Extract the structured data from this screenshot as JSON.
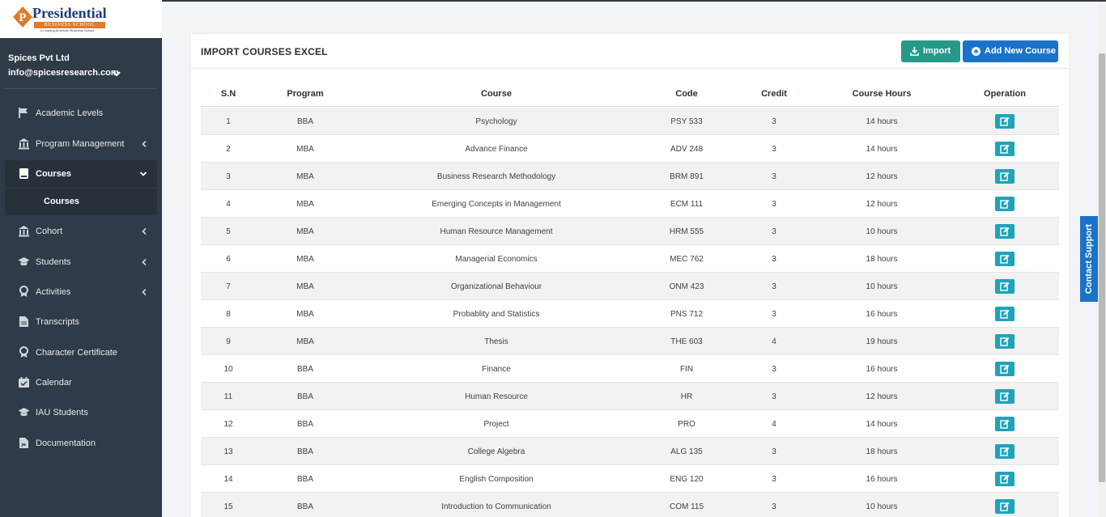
{
  "brand": {
    "title": "Presidential",
    "subtitle": "BUSINESS SCHOOL",
    "tagline": "A Leading American Business School"
  },
  "user": {
    "org": "Spices Pvt Ltd",
    "email": "info@spicesresearch.com"
  },
  "sidebar": {
    "items": [
      {
        "label": "Academic Levels",
        "icon": "flag-icon",
        "caret": false
      },
      {
        "label": "Program Management",
        "icon": "institution-icon",
        "caret": true
      },
      {
        "label": "Courses",
        "icon": "book-icon",
        "caret": true,
        "active": true
      },
      {
        "label": "Cohort",
        "icon": "institution-icon",
        "caret": true
      },
      {
        "label": "Students",
        "icon": "graduation-cap-icon",
        "caret": true
      },
      {
        "label": "Activities",
        "icon": "award-icon",
        "caret": true
      },
      {
        "label": "Transcripts",
        "icon": "file-icon",
        "caret": false
      },
      {
        "label": "Character Certificate",
        "icon": "award-icon",
        "caret": false
      },
      {
        "label": "Calendar",
        "icon": "calendar-icon",
        "caret": false
      },
      {
        "label": "IAU Students",
        "icon": "graduation-cap-icon",
        "caret": false
      },
      {
        "label": "Documentation",
        "icon": "pdf-file-icon",
        "caret": false
      }
    ],
    "sub_item": "Courses"
  },
  "page": {
    "title": "IMPORT COURSES EXCEL",
    "import_label": "Import",
    "add_label": "Add New Course"
  },
  "contact_support": "Contact Support",
  "table": {
    "headers": [
      "S.N",
      "Program",
      "Course",
      "Code",
      "Credit",
      "Course Hours",
      "Operation"
    ],
    "rows": [
      [
        "1",
        "BBA",
        "Psychology",
        "PSY 533",
        "3",
        "14 hours"
      ],
      [
        "2",
        "MBA",
        "Advance Finance",
        "ADV 248",
        "3",
        "14 hours"
      ],
      [
        "3",
        "MBA",
        "Business Research Methodology",
        "BRM 891",
        "3",
        "12 hours"
      ],
      [
        "4",
        "MBA",
        "Emerging Concepts in Management",
        "ECM 111",
        "3",
        "12 hours"
      ],
      [
        "5",
        "MBA",
        "Human Resource Management",
        "HRM 555",
        "3",
        "10 hours"
      ],
      [
        "6",
        "MBA",
        "Managerial Economics",
        "MEC 762",
        "3",
        "18 hours"
      ],
      [
        "7",
        "MBA",
        "Organizational Behaviour",
        "ONM 423",
        "3",
        "10 hours"
      ],
      [
        "8",
        "MBA",
        "Probablity and Statistics",
        "PNS 712",
        "3",
        "16 hours"
      ],
      [
        "9",
        "MBA",
        "Thesis",
        "THE 603",
        "4",
        "19 hours"
      ],
      [
        "10",
        "BBA",
        "Finance",
        "FIN",
        "3",
        "16 hours"
      ],
      [
        "11",
        "BBA",
        "Human Resource",
        "HR",
        "3",
        "12 hours"
      ],
      [
        "12",
        "BBA",
        "Project",
        "PRO",
        "4",
        "14 hours"
      ],
      [
        "13",
        "BBA",
        "College Algebra",
        "ALG 135",
        "3",
        "18 hours"
      ],
      [
        "14",
        "BBA",
        "English Composition",
        "ENG 120",
        "3",
        "16 hours"
      ],
      [
        "15",
        "BBA",
        "Introduction to Communication",
        "COM 115",
        "3",
        "10 hours"
      ]
    ]
  }
}
